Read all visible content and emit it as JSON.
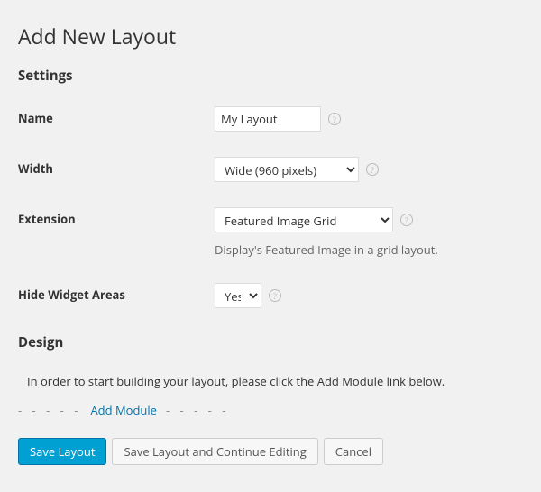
{
  "page_title": "Add New Layout",
  "sections": {
    "settings_heading": "Settings",
    "design_heading": "Design"
  },
  "fields": {
    "name": {
      "label": "Name",
      "value": "My Layout"
    },
    "width": {
      "label": "Width",
      "selected": "Wide (960 pixels)"
    },
    "extension": {
      "label": "Extension",
      "selected": "Featured Image Grid",
      "description": "Display's Featured Image in a grid layout."
    },
    "hide_widget_areas": {
      "label": "Hide Widget Areas",
      "selected": "Yes"
    }
  },
  "design": {
    "intro": "In order to start building your layout, please click the Add Module link below.",
    "add_module_label": "Add Module"
  },
  "buttons": {
    "save": "Save Layout",
    "save_continue": "Save Layout and Continue Editing",
    "cancel": "Cancel"
  }
}
